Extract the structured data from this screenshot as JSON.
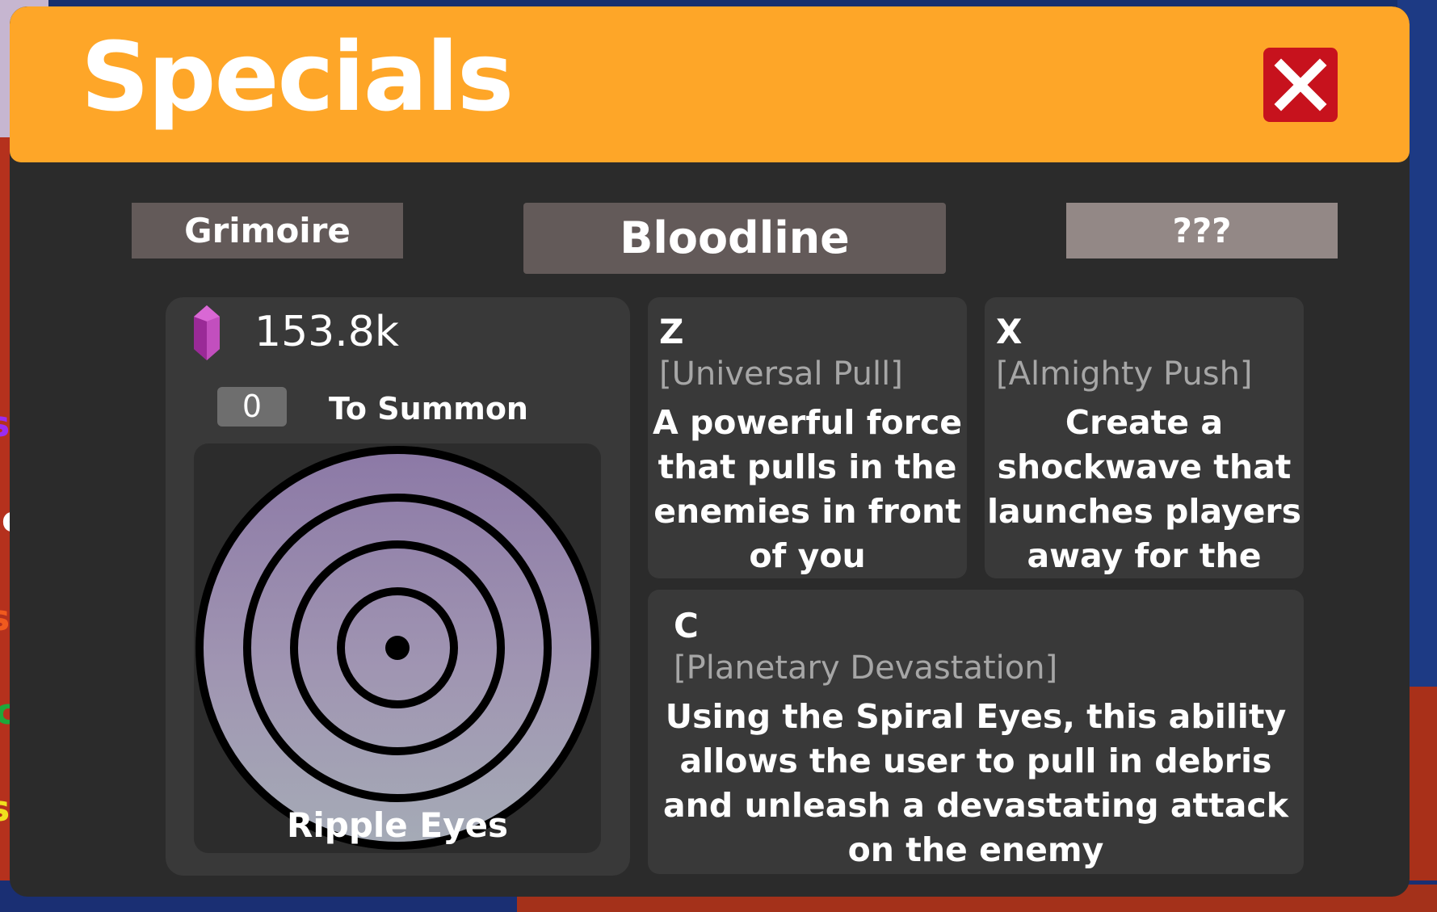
{
  "background": {
    "side_labels": [
      {
        "text": "s",
        "color": "#9b2cf0"
      },
      {
        "text": "ons",
        "color": "#ffffff"
      },
      {
        "text": "s",
        "color": "#f05a1e"
      },
      {
        "text": "cials",
        "color": "#1ea83a"
      },
      {
        "text": "s",
        "color": "#f0e01e"
      }
    ]
  },
  "header": {
    "title": "Specials",
    "close_icon": "close-x-icon",
    "accent_color": "#fea628",
    "close_color": "#c7121d"
  },
  "tabs": [
    {
      "label": "Grimoire"
    },
    {
      "label": "Bloodline"
    },
    {
      "label": "???"
    }
  ],
  "summon": {
    "gem_icon": "purple-crystal-icon",
    "gem_count": "153.8k",
    "summon_value": "0",
    "summon_label": "To Summon",
    "eye_name": "Ripple Eyes"
  },
  "abilities": [
    {
      "key": "Z",
      "name": "[Universal Pull]",
      "description": "A powerful force that pulls in the enemies in front of you"
    },
    {
      "key": "X",
      "name": "[Almighty Push]",
      "description": "Create a shockwave that launches players away for the user"
    },
    {
      "key": "C",
      "name": "[Planetary Devastation]",
      "description": "Using the Spiral Eyes, this ability allows the user to pull in debris and unleash a devastating attack on the enemy"
    }
  ]
}
